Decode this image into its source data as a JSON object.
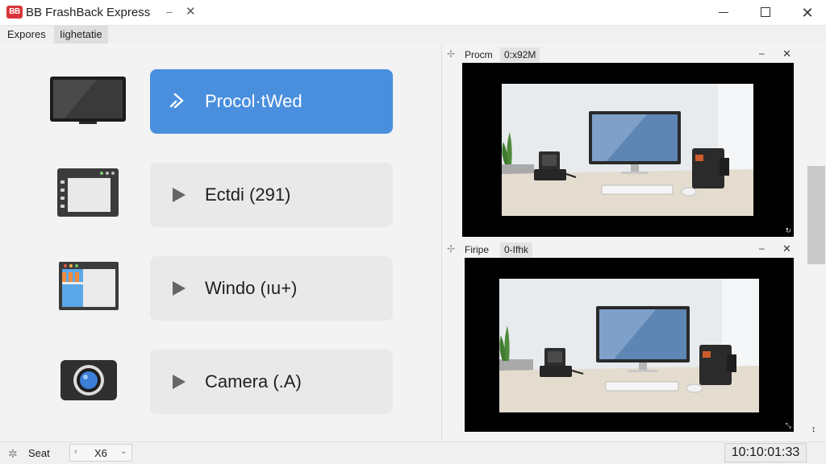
{
  "window": {
    "app_logo": "BB",
    "title": "BB FrashBack Express",
    "small_min": "–",
    "small_close": "✕",
    "close_glyph": "✕"
  },
  "menu": {
    "items": [
      {
        "label": "Expores",
        "active": false
      },
      {
        "label": "Iighetatie",
        "active": true
      }
    ]
  },
  "options": [
    {
      "label": "Procol·tWed",
      "icon": "monitor-icon",
      "primary": true
    },
    {
      "label": "Ectdi (291)",
      "icon": "app-window-icon",
      "primary": false
    },
    {
      "label": "Windo (ıu+)",
      "icon": "window-icon",
      "primary": false
    },
    {
      "label": "Camera (.A)",
      "icon": "camera-icon",
      "primary": false
    }
  ],
  "panes": [
    {
      "title": "Procm",
      "tag": "0:x92M",
      "min": "–",
      "close": "✕",
      "corner": "↻"
    },
    {
      "title": "Firipe",
      "tag": "0-Ifhk",
      "min": "–",
      "close": "✕",
      "corner": "⤡"
    }
  ],
  "status": {
    "label": "Seat",
    "select_left": "‹",
    "select_value": "X6",
    "select_dropdown": "⌄",
    "time": "10:10:01:33"
  },
  "scrollbar": {
    "end_glyph": "↕"
  },
  "colors": {
    "accent": "#4a8fde",
    "logo": "#d9343a",
    "option_bg": "#e9e9e9"
  }
}
